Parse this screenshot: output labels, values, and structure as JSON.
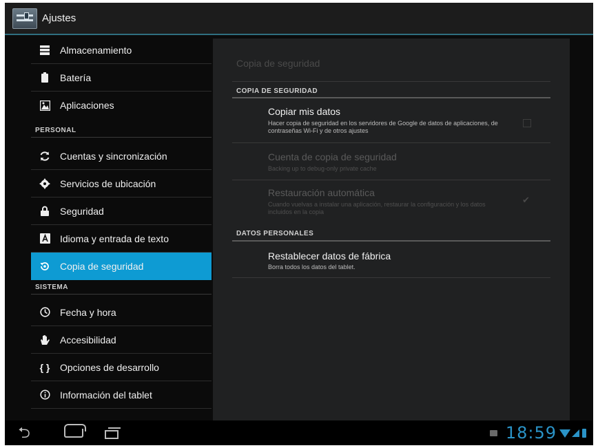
{
  "action_bar": {
    "title": "Ajustes",
    "icon": "settings-icon"
  },
  "sidebar": {
    "items": [
      {
        "label": "Almacenamiento",
        "icon": "storage-icon",
        "selected": false
      },
      {
        "label": "Batería",
        "icon": "battery-icon",
        "selected": false
      },
      {
        "label": "Aplicaciones",
        "icon": "apps-icon",
        "selected": false
      },
      {
        "label": "Cuentas y sincronización",
        "icon": "sync-icon",
        "selected": false
      },
      {
        "label": "Servicios de ubicación",
        "icon": "location-icon",
        "selected": false
      },
      {
        "label": "Seguridad",
        "icon": "lock-icon",
        "selected": false
      },
      {
        "label": "Idioma y entrada de texto",
        "icon": "language-icon",
        "selected": false
      },
      {
        "label": "Copia de seguridad",
        "icon": "backup-icon",
        "selected": true
      },
      {
        "label": "Fecha y hora",
        "icon": "clock-icon",
        "selected": false
      },
      {
        "label": "Accesibilidad",
        "icon": "hand-icon",
        "selected": false
      },
      {
        "label": "Opciones de desarrollo",
        "icon": "braces-icon",
        "selected": false
      },
      {
        "label": "Información del tablet",
        "icon": "info-icon",
        "selected": false
      }
    ],
    "sections": {
      "personal": "PERSONAL",
      "sistema": "SISTEMA"
    }
  },
  "content": {
    "title": "Copia de seguridad",
    "backup_header": "COPIA DE SEGURIDAD",
    "personal_header": "DATOS PERSONALES",
    "prefs": [
      {
        "title": "Copiar mis datos",
        "summary": "Hacer copia de seguridad en los servidores de Google de datos de aplicaciones, de contraseñas Wi-Fi y de otros ajustes",
        "checked": false,
        "enabled": true
      },
      {
        "title": "Cuenta de copia de seguridad",
        "summary": "Backing up to debug-only private cache",
        "enabled": false
      },
      {
        "title": "Restauración automática",
        "summary": "Cuando vuelvas a instalar una aplicación, restaurar la configuración y los datos incluidos en la copia",
        "checked": true,
        "enabled": false
      },
      {
        "title": "Restablecer datos de fábrica",
        "summary": "Borra todos los datos del tablet.",
        "enabled": true
      }
    ]
  },
  "navbar": {
    "clock": "18:59",
    "accent": "#2a93c7"
  },
  "colors": {
    "selected_bg": "#0e9bd3",
    "accent_line": "#2f6f80"
  }
}
